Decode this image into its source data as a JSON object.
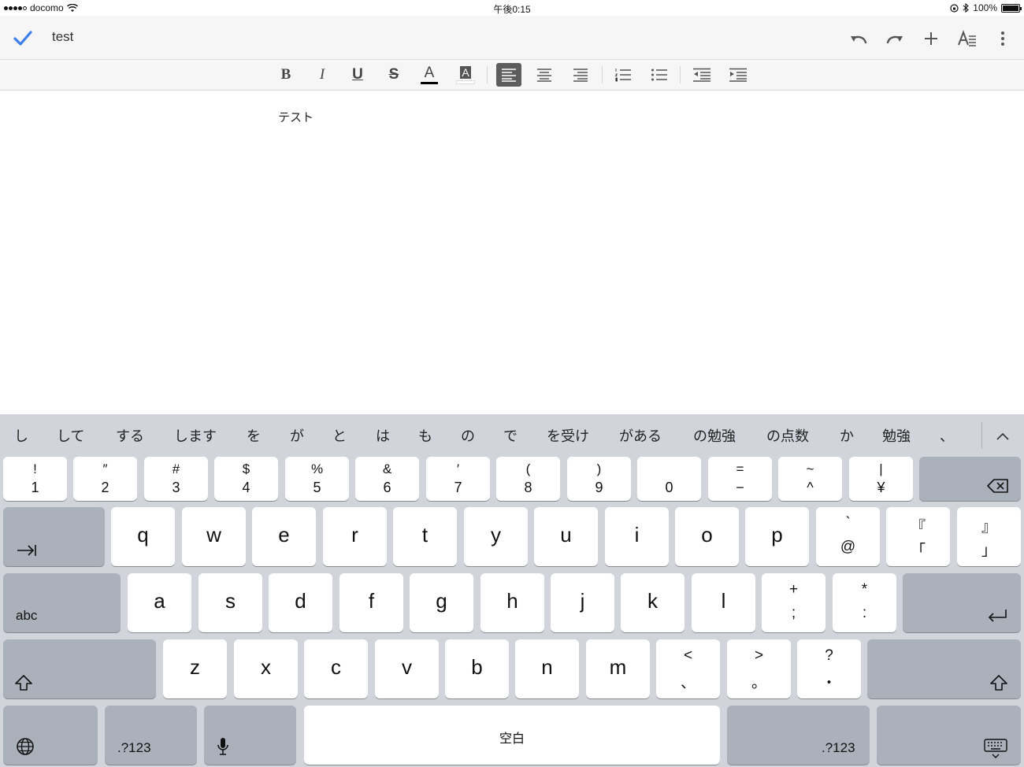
{
  "status_bar": {
    "carrier": "docomo",
    "time": "午後0:15",
    "battery": "100%"
  },
  "header": {
    "title": "test"
  },
  "document": {
    "body_text": "テスト"
  },
  "format_toolbar": {
    "bold": "B",
    "italic": "I",
    "underline": "U",
    "strikethrough": "S",
    "text_color": "A",
    "highlight": "A"
  },
  "keyboard": {
    "suggestions": [
      "し",
      "して",
      "する",
      "します",
      "を",
      "が",
      "と",
      "は",
      "も",
      "の",
      "で",
      "を受け",
      "がある",
      "の勉強",
      "の点数",
      "か",
      "勉強",
      "、"
    ],
    "number_row": [
      {
        "up": "!",
        "dn": "1"
      },
      {
        "up": "″",
        "dn": "2"
      },
      {
        "up": "#",
        "dn": "3"
      },
      {
        "up": "$",
        "dn": "4"
      },
      {
        "up": "%",
        "dn": "5"
      },
      {
        "up": "&",
        "dn": "6"
      },
      {
        "up": "′",
        "dn": "7"
      },
      {
        "up": "(",
        "dn": "8"
      },
      {
        "up": ")",
        "dn": "9"
      },
      {
        "up": "",
        "dn": "0"
      },
      {
        "up": "=",
        "dn": "−"
      },
      {
        "up": "~",
        "dn": "^"
      },
      {
        "up": "|",
        "dn": "¥"
      }
    ],
    "row_q": [
      "q",
      "w",
      "e",
      "r",
      "t",
      "y",
      "u",
      "i",
      "o",
      "p"
    ],
    "row_q_sym": [
      {
        "up": "`",
        "dn": "@"
      },
      {
        "up": "『",
        "dn": "「"
      },
      {
        "up": "』",
        "dn": "」"
      }
    ],
    "row_a": [
      "a",
      "s",
      "d",
      "f",
      "g",
      "h",
      "j",
      "k",
      "l"
    ],
    "row_a_sym": [
      {
        "up": "+",
        "dn": ";"
      },
      {
        "up": "*",
        "dn": ":"
      }
    ],
    "row_z": [
      "z",
      "x",
      "c",
      "v",
      "b",
      "n",
      "m"
    ],
    "row_z_sym": [
      {
        "up": "<",
        "dn": "、"
      },
      {
        "up": ">",
        "dn": "。"
      },
      {
        "up": "?",
        "dn": "・"
      }
    ],
    "abc_label": "abc",
    "numbers_label": ".?123",
    "space_label": "空白"
  }
}
